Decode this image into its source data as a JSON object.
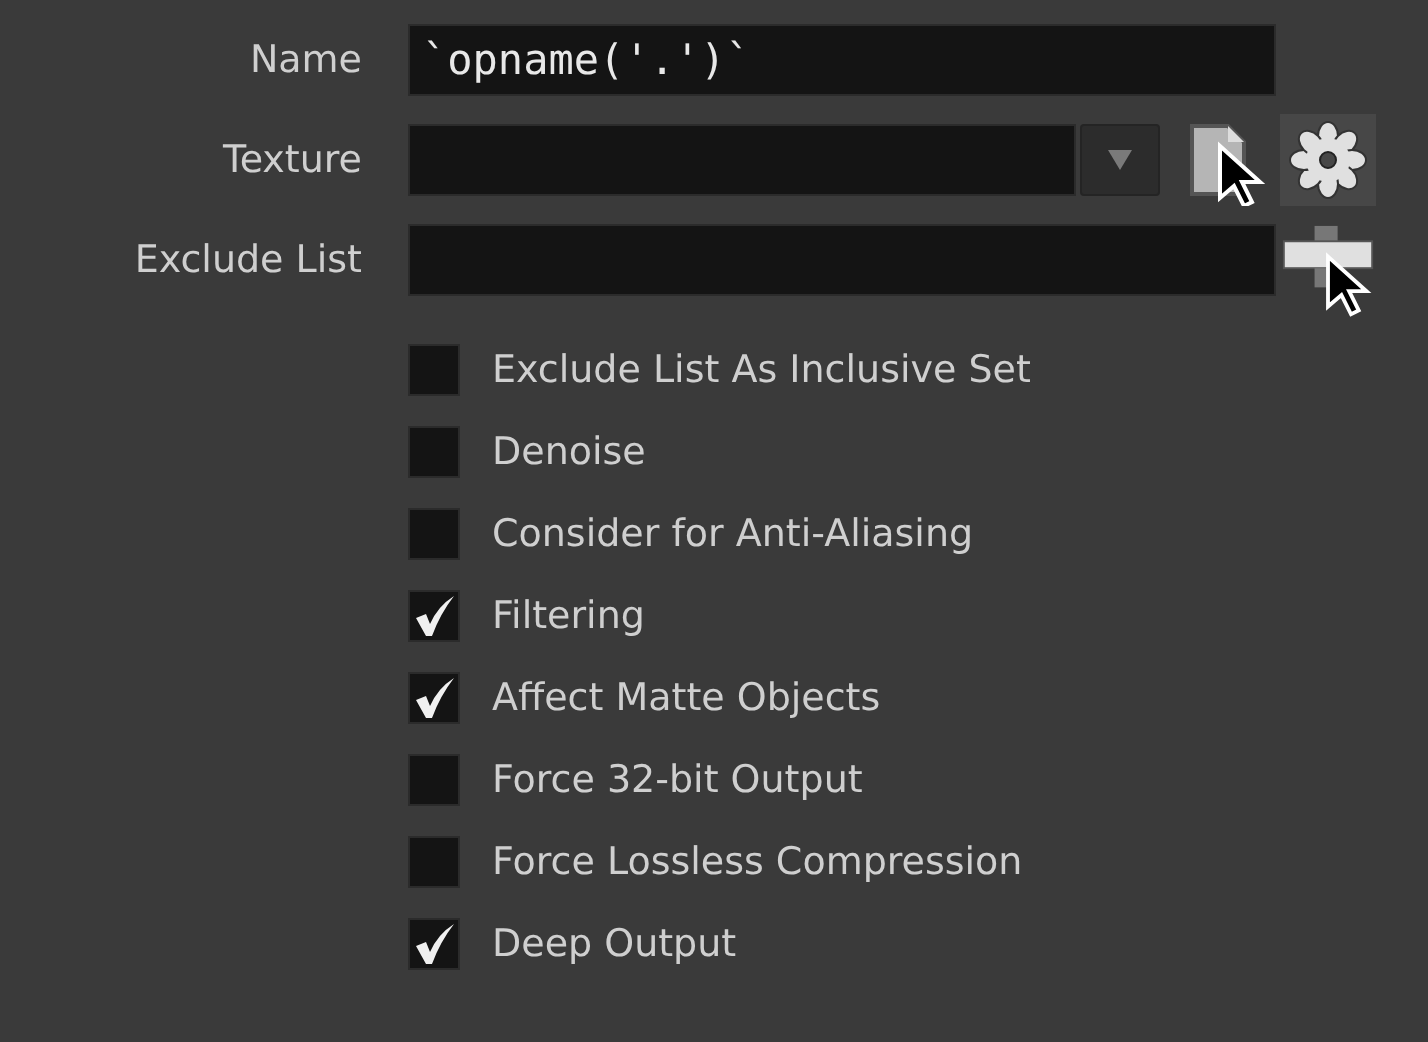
{
  "parameters": [
    {
      "label": "Name",
      "kind": "text",
      "value": "`opname('.')`"
    },
    {
      "label": "Texture",
      "kind": "dropdown"
    },
    {
      "label": "Exclude List",
      "kind": "list"
    }
  ],
  "options": [
    {
      "label": "Exclude List As Inclusive Set",
      "checked": false
    },
    {
      "label": "Denoise",
      "checked": false
    },
    {
      "label": "Consider for Anti-Aliasing",
      "checked": false
    },
    {
      "label": "Filtering",
      "checked": true
    },
    {
      "label": "Affect Matte Objects",
      "checked": true
    },
    {
      "label": "Force 32-bit Output",
      "checked": false
    },
    {
      "label": "Force Lossless Compression",
      "checked": false
    },
    {
      "label": "Deep Output",
      "checked": true
    }
  ]
}
